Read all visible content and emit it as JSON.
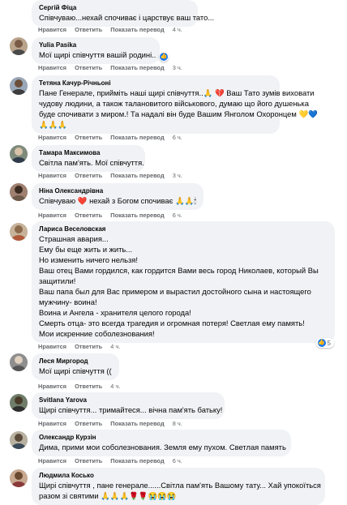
{
  "actions": {
    "like": "Нравится",
    "reply": "Ответить",
    "translate": "Показать перевод"
  },
  "comments": [
    {
      "author": "Сергій Фіца",
      "lines": [
        "Співчуваю...нехай спочиває і царствує ваш тато..."
      ],
      "time": "4 ч."
    },
    {
      "author": "Yulia Pasika",
      "lines": [
        "Мої щирі співчуття вашій родині.."
      ],
      "time": "3 ч."
    },
    {
      "author": "Тетяна Качур-Річньоні",
      "lines": [
        "Пане Генерале, прийміть наші щирі співчуття..🙏 💔 Ваш Тато зумів виховати",
        "чудову людини, а також талановитого військового, думаю що його душенька",
        "буде спочивати з миром.! Та надалі він буде Вашим Янголом Охоронцем 💛💙",
        "🙏🙏🙏"
      ],
      "time": "6 ч."
    },
    {
      "author": "Тамара Максимова",
      "lines": [
        "Світла пам'ять. Мої співчуття."
      ],
      "time": "3 ч."
    },
    {
      "author": "Ніна Олександрівна",
      "lines": [
        "Співчуваю ❤️ нехай з Богом спочиває 🙏🙏🕯"
      ],
      "time": "6 ч."
    },
    {
      "author": "Лариса Веселовская",
      "lines": [
        "Страшная авария...",
        "Ему бы еще жить и жить...",
        "Но изменить ничего нельзя!",
        "Ваш отец Вами гордился, как гордится Вами весь город Николаев, который Вы",
        "защитили!",
        "Ваш папа был для Вас примером и вырастил достойного сына и настоящего",
        "мужчину- воина!",
        "Воина и Ангела - хранителя целого города!",
        "Смерть отца- это всегда трагедия и огромная потеря! Светлая ему память!",
        "Мои искренние соболезнования!"
      ],
      "time": "4 ч.",
      "reaction_count": "5"
    },
    {
      "author": "Леся Миргород",
      "lines": [
        "Мої щирі співчуття (("
      ],
      "time": "4 ч."
    },
    {
      "author": "Svitlana Yarova",
      "lines": [
        "Щирі співчуття... тримайтеся... вічна пам'ять батьку!"
      ],
      "time": "8 ч."
    },
    {
      "author": "Олександр Курзін",
      "lines": [
        "Дима, прими мои соболезнования. Земля ему пухом. Светлая память"
      ],
      "time": "6 ч."
    },
    {
      "author": "Людмила Косько",
      "lines": [
        "Щирі співчуття , пане генерале......Світла пам'ять Вашому тату... Хай упокоїться",
        "разом зі святими 🙏🙏🙏🌹🌹😭😭😭"
      ],
      "time": ""
    }
  ],
  "colors": {
    "bubble": "#f0f2f5",
    "meta": "#65676b",
    "like": "#1877f2"
  }
}
